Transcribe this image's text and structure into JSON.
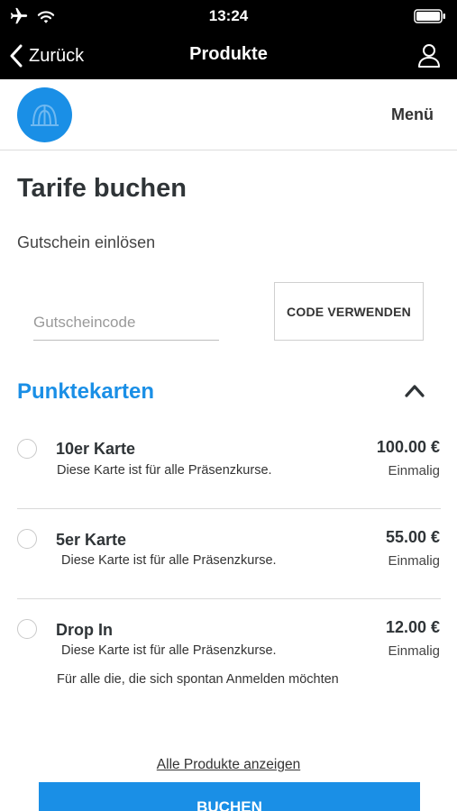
{
  "status_bar": {
    "time": "13:24",
    "icons": [
      "airplane-icon",
      "wifi-icon",
      "battery-icon"
    ]
  },
  "nav": {
    "back_label": "Zurück",
    "title": "Produkte",
    "icons": [
      "chevron-left-icon",
      "user-icon"
    ]
  },
  "header": {
    "menu_label": "Menü",
    "logo_icon": "logo-icon"
  },
  "main": {
    "title": "Tarife buchen",
    "voucher": {
      "heading": "Gutschein einlösen",
      "placeholder": "Gutscheincode",
      "value": "",
      "button_label": "CODE VERWENDEN"
    },
    "section": {
      "title": "Punktekarten",
      "toggle_icon": "chevron-up-icon"
    },
    "products": [
      {
        "name": "10er Karte",
        "description": "Diese Karte ist für alle Präsenzkurse.",
        "price": "100.00 €",
        "frequency": "Einmalig",
        "extra": ""
      },
      {
        "name": "5er Karte",
        "description": "Diese Karte ist für alle Präsenzkurse.",
        "price": "55.00 €",
        "frequency": "Einmalig",
        "extra": ""
      },
      {
        "name": "Drop In",
        "description": "Diese Karte ist für alle Präsenzkurse.",
        "price": "12.00 €",
        "frequency": "Einmalig",
        "extra": "Für alle die, die sich spontan Anmelden möchten"
      }
    ],
    "all_products_link": "Alle Produkte anzeigen",
    "book_button": "BUCHEN"
  },
  "colors": {
    "accent": "#1a8fe6",
    "bar_background": "#000000",
    "text": "#2f3437"
  }
}
